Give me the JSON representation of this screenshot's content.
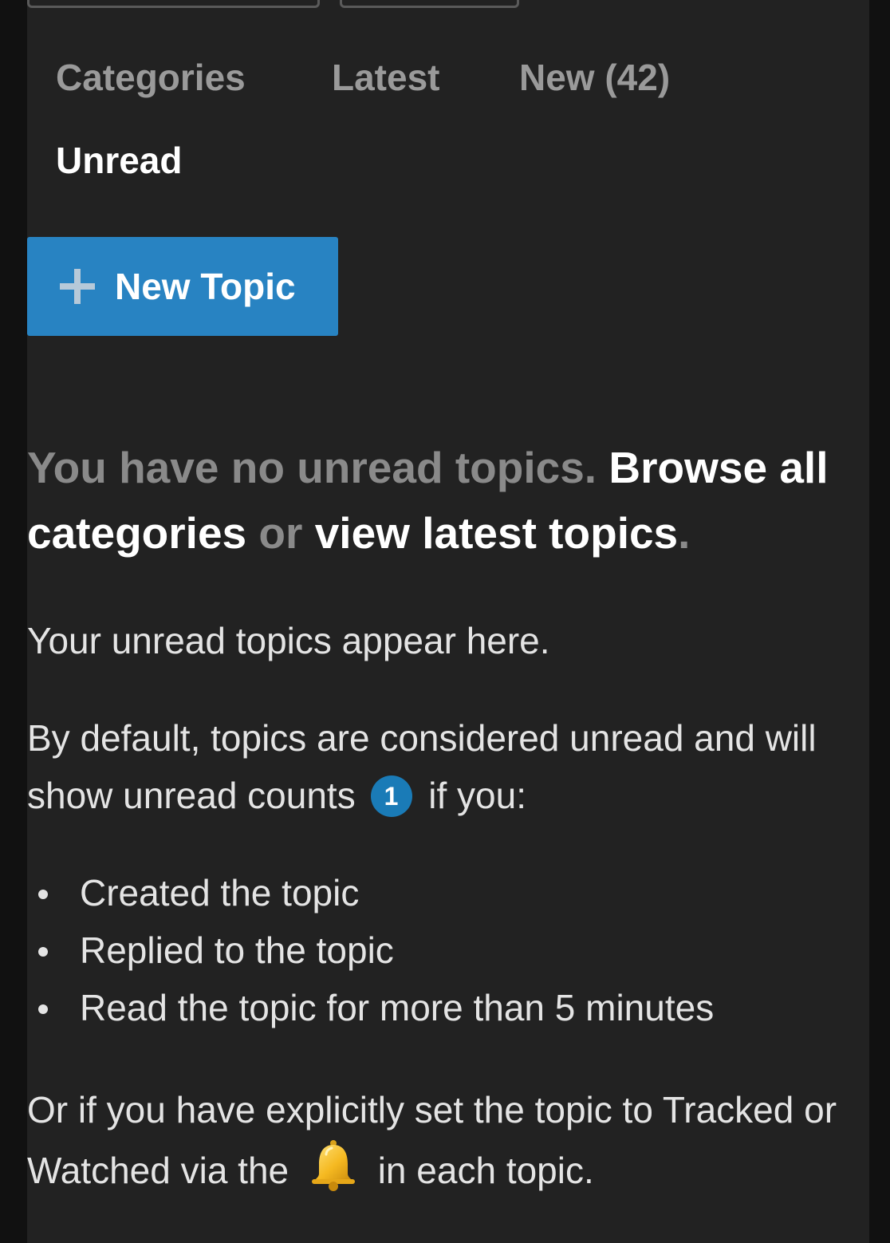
{
  "nav": {
    "tabs": [
      {
        "label": "Categories"
      },
      {
        "label": "Latest"
      },
      {
        "label": "New (42)"
      },
      {
        "label": "Unread"
      }
    ],
    "active_tab": "Unread"
  },
  "actions": {
    "new_topic_label": "New Topic",
    "new_topic_icon": "plus-icon",
    "new_topic_color": "#2883c2"
  },
  "empty_state": {
    "lead_prefix": "You have no unread topics.",
    "browse_link": "Browse all categories",
    "or_text": "or",
    "latest_link": "view latest topics",
    "lead_suffix": ".",
    "intro": "Your unread topics appear here.",
    "default_text_before_badge": "By default, topics are considered unread and will show unread counts",
    "badge_count": "1",
    "default_text_after_badge": "if you:",
    "reasons": [
      "Created the topic",
      "Replied to the topic",
      "Read the topic for more than 5 minutes"
    ],
    "tracked_text_before_icon": "Or if you have explicitly set the topic to Tracked or Watched via the",
    "tracked_icon": "bell-icon",
    "tracked_text_after_icon": "in each topic."
  }
}
